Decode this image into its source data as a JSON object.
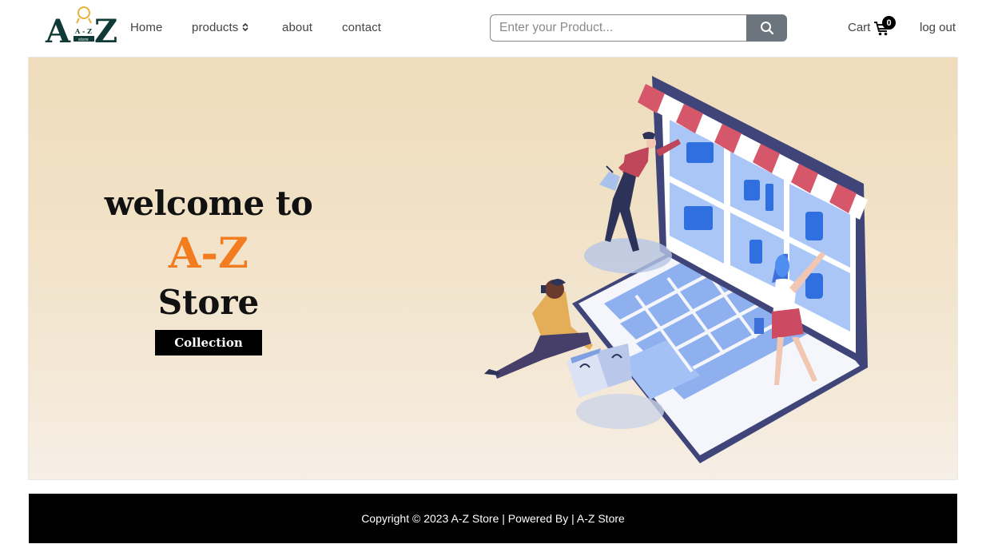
{
  "brand": {
    "logo_text": "A-Z",
    "logo_sub": "store",
    "accent": "#f47c20",
    "logo_color": "#0f3a35",
    "logo_gold": "#e8b23a"
  },
  "nav": {
    "home": "Home",
    "products": "products",
    "about": "about",
    "contact": "contact"
  },
  "search": {
    "placeholder": "Enter your Product...",
    "value": "",
    "button_icon": "search-icon"
  },
  "cart": {
    "label": "Cart",
    "count": "0",
    "icon": "cart-icon"
  },
  "logout": "log out",
  "hero": {
    "welcome": "welcome to",
    "brand": "A-Z",
    "store": "Store",
    "button": "Collection"
  },
  "footer": {
    "copyright": "Copyright © 2023 A-Z Store | Powered By | A-Z Store"
  }
}
